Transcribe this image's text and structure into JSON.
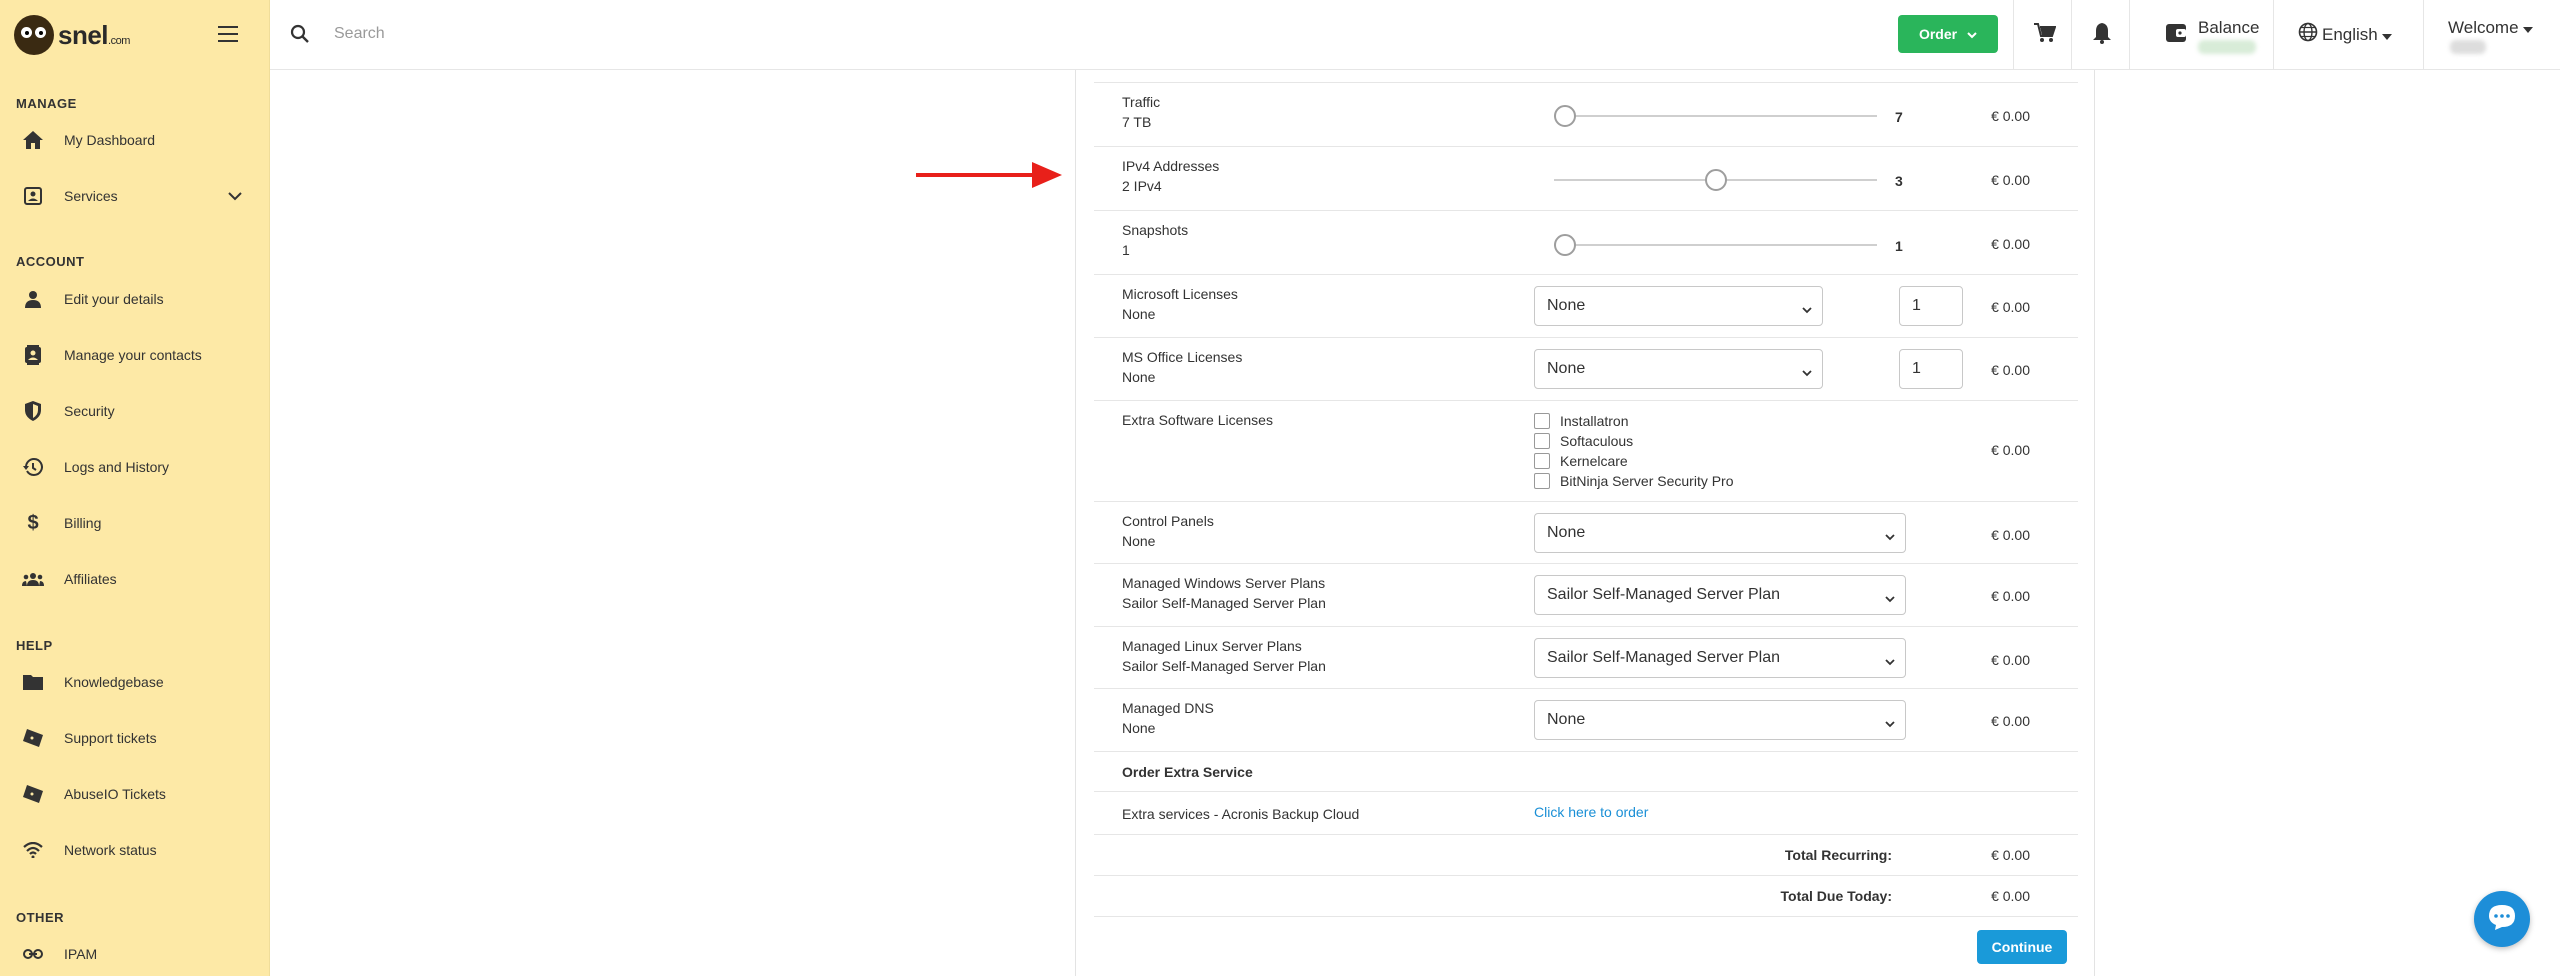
{
  "logo": {
    "name": "snel",
    "suffix": ".com"
  },
  "sidebar": {
    "sections": [
      {
        "title": "MANAGE"
      },
      {
        "title": "ACCOUNT"
      },
      {
        "title": "HELP"
      },
      {
        "title": "OTHER"
      }
    ],
    "items": [
      {
        "label": "My Dashboard",
        "icon": "home-icon"
      },
      {
        "label": "Services",
        "icon": "services-icon"
      },
      {
        "label": "Edit your details",
        "icon": "person-icon"
      },
      {
        "label": "Manage your contacts",
        "icon": "contacts-icon"
      },
      {
        "label": "Security",
        "icon": "shield-icon"
      },
      {
        "label": "Logs and History",
        "icon": "history-icon"
      },
      {
        "label": "Billing",
        "icon": "dollar-icon"
      },
      {
        "label": "Affiliates",
        "icon": "group-icon"
      },
      {
        "label": "Knowledgebase",
        "icon": "folder-icon"
      },
      {
        "label": "Support tickets",
        "icon": "ticket-icon"
      },
      {
        "label": "AbuseIO Tickets",
        "icon": "ticket-icon"
      },
      {
        "label": "Network status",
        "icon": "wifi-icon"
      },
      {
        "label": "IPAM",
        "icon": "link-icon"
      }
    ]
  },
  "topbar": {
    "search_placeholder": "Search",
    "order_label": "Order",
    "balance_label": "Balance",
    "language": "English",
    "welcome": "Welcome"
  },
  "config": {
    "sliders": [
      {
        "label": "Traffic",
        "sub": "7 TB",
        "value": "7",
        "fraction": 0,
        "price": "€ 0.00"
      },
      {
        "label": "IPv4 Addresses",
        "sub": "2 IPv4",
        "value": "3",
        "fraction": 0.5,
        "price": "€ 0.00"
      },
      {
        "label": "Snapshots",
        "sub": "1",
        "value": "1",
        "fraction": 0,
        "price": "€ 0.00"
      }
    ],
    "microsoft": {
      "label": "Microsoft Licenses",
      "sub": "None",
      "select": "None",
      "qty": "1",
      "price": "€ 0.00"
    },
    "msoffice": {
      "label": "MS Office Licenses",
      "sub": "None",
      "select": "None",
      "qty": "1",
      "price": "€ 0.00"
    },
    "extra_software": {
      "label": "Extra Software Licenses",
      "options": [
        "Installatron",
        "Softaculous",
        "Kernelcare",
        "BitNinja Server Security Pro"
      ],
      "price": "€ 0.00"
    },
    "control_panels": {
      "label": "Control Panels",
      "sub": "None",
      "select": "None",
      "price": "€ 0.00"
    },
    "managed_windows": {
      "label": "Managed Windows Server Plans",
      "sub": "Sailor Self-Managed Server Plan",
      "select": "Sailor Self-Managed Server Plan",
      "price": "€ 0.00"
    },
    "managed_linux": {
      "label": "Managed Linux Server Plans",
      "sub": "Sailor Self-Managed Server Plan",
      "select": "Sailor Self-Managed Server Plan",
      "price": "€ 0.00"
    },
    "managed_dns": {
      "label": "Managed DNS",
      "sub": "None",
      "select": "None",
      "price": "€ 0.00"
    },
    "order_extra_title": "Order Extra Service",
    "extra_services": {
      "label": "Extra services - Acronis Backup Cloud",
      "link": "Click here to order"
    },
    "total_recurring": {
      "label": "Total Recurring:",
      "value": "€ 0.00"
    },
    "total_due": {
      "label": "Total Due Today:",
      "value": "€ 0.00"
    },
    "continue_label": "Continue"
  },
  "colors": {
    "sidebar_bg": "#fde9a6",
    "order_green": "#2ab55b",
    "continue_blue": "#1a9ad9",
    "link_blue": "#1a8fd6",
    "arrow_red": "#e8201a"
  }
}
